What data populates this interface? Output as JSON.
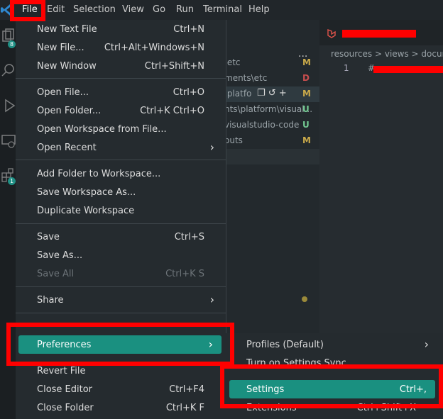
{
  "menubar": {
    "items": [
      "File",
      "Edit",
      "Selection",
      "View",
      "Go",
      "Run",
      "Terminal",
      "Help"
    ],
    "active": "File"
  },
  "activity_badges": [
    "8",
    "1"
  ],
  "sidebar": {
    "more_actions": "...",
    "files": [
      {
        "name": ".etc",
        "status": "M",
        "status_color": "#c9a94a"
      },
      {
        "name": "ments\\etc",
        "status": "D",
        "status_color": "#c74e4e"
      },
      {
        "name": ".platfo",
        "status": "M",
        "status_color": "#c9a94a"
      },
      {
        "name": "nts\\platform\\visual...",
        "status": "U",
        "status_color": "#73c991"
      },
      {
        "name": "visualstudio-code",
        "status": "U",
        "status_color": "#73c991"
      },
      {
        "name": "outs",
        "status": "M",
        "status_color": "#c9a94a"
      }
    ]
  },
  "editor": {
    "breadcrumbs": "resources > views > docum",
    "line_number": "1",
    "line_text": "#"
  },
  "file_menu": {
    "groups": [
      [
        {
          "label": "New Text File",
          "shortcut": "Ctrl+N"
        },
        {
          "label": "New File...",
          "shortcut": "Ctrl+Alt+Windows+N"
        },
        {
          "label": "New Window",
          "shortcut": "Ctrl+Shift+N"
        }
      ],
      [
        {
          "label": "Open File...",
          "shortcut": "Ctrl+O"
        },
        {
          "label": "Open Folder...",
          "shortcut": "Ctrl+K Ctrl+O"
        },
        {
          "label": "Open Workspace from File..."
        },
        {
          "label": "Open Recent",
          "submenu": true
        }
      ],
      [
        {
          "label": "Add Folder to Workspace..."
        },
        {
          "label": "Save Workspace As..."
        },
        {
          "label": "Duplicate Workspace"
        }
      ],
      [
        {
          "label": "Save",
          "shortcut": "Ctrl+S"
        },
        {
          "label": "Save As..."
        },
        {
          "label": "Save All",
          "shortcut": "Ctrl+K S",
          "disabled": true
        }
      ],
      [
        {
          "label": "Share",
          "submenu": true
        }
      ],
      [
        {
          "label": "Preferences",
          "submenu": true,
          "highlighted": true
        }
      ],
      [
        {
          "label": "Revert File"
        },
        {
          "label": "Close Editor",
          "shortcut": "Ctrl+F4"
        },
        {
          "label": "Close Folder",
          "shortcut": "Ctrl+K F"
        }
      ]
    ]
  },
  "preferences_submenu": {
    "items": [
      {
        "label": "Profiles (Default)",
        "submenu": true
      },
      {
        "label": "Turn on Settings Sync"
      },
      {
        "label": "Settings",
        "shortcut": "Ctrl+,",
        "highlighted": true
      },
      {
        "label": "Extensions",
        "shortcut": "Ctrl+Shift+X"
      }
    ]
  },
  "colors": {
    "accent": "#1a9080",
    "callout": "#ff0000",
    "menu_bg": "#252b2f"
  }
}
